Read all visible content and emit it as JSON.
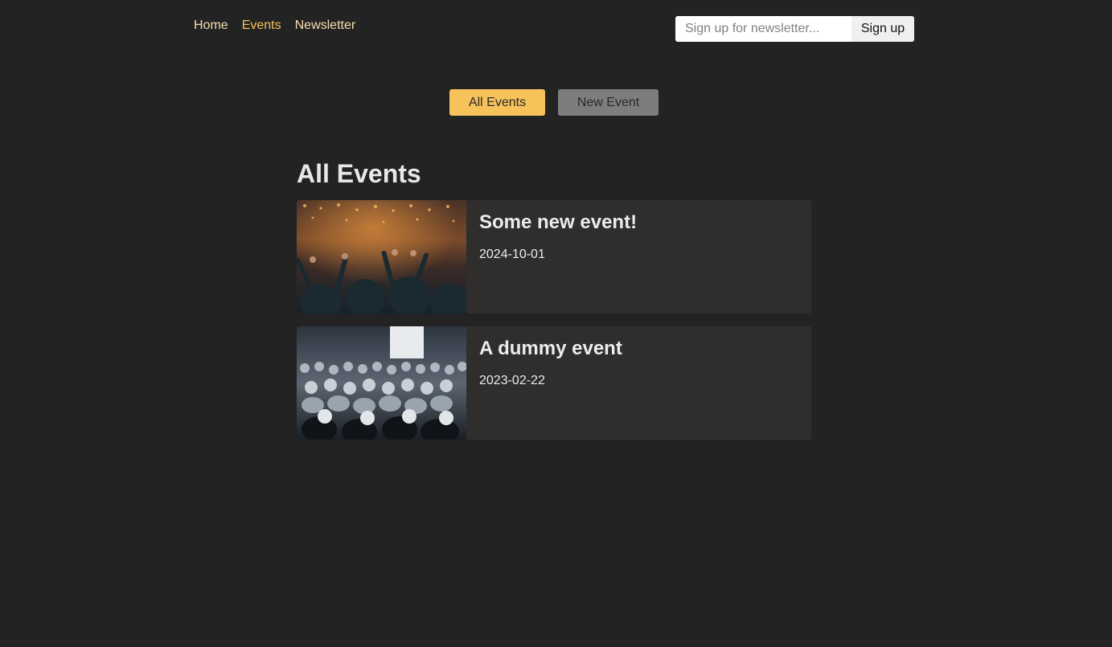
{
  "nav": {
    "items": [
      {
        "label": "Home",
        "active": false
      },
      {
        "label": "Events",
        "active": true
      },
      {
        "label": "Newsletter",
        "active": false
      }
    ]
  },
  "newsletter": {
    "placeholder": "Sign up for newsletter...",
    "value": "",
    "button_label": "Sign up"
  },
  "subnav": {
    "all_events_label": "All Events",
    "new_event_label": "New Event"
  },
  "main": {
    "title": "All Events",
    "events": [
      {
        "title": "Some new event!",
        "date": "2024-10-01",
        "image": "concert-crowd-photo"
      },
      {
        "title": "A dummy event",
        "date": "2023-02-22",
        "image": "conference-audience-photo"
      }
    ]
  },
  "colors": {
    "background": "#232323",
    "accent": "#f6c25a",
    "nav_text": "#f5deb0",
    "card_background": "#302e2c",
    "secondary_button": "#7e7d7b"
  }
}
